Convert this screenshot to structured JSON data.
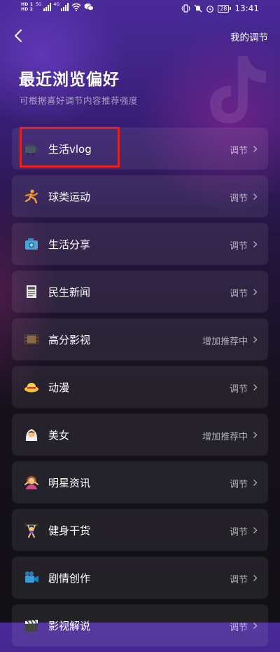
{
  "status_bar": {
    "hd1": "HD 1",
    "hd2": "HD 2",
    "net1": "5G",
    "net2": "4G",
    "battery": "28",
    "time": "13:41"
  },
  "nav": {
    "right_link": "我的调节"
  },
  "header": {
    "title": "最近浏览偏好",
    "subtitle": "可根据喜好调节内容推荐强度"
  },
  "items": [
    {
      "label": "生活vlog",
      "action": "调节",
      "icon": "camera-icon"
    },
    {
      "label": "球类运动",
      "action": "调节",
      "icon": "sports-icon"
    },
    {
      "label": "生活分享",
      "action": "调节",
      "icon": "share-icon"
    },
    {
      "label": "民生新闻",
      "action": "调节",
      "icon": "newspaper-icon"
    },
    {
      "label": "高分影视",
      "action": "增加推荐中",
      "icon": "film-icon"
    },
    {
      "label": "动漫",
      "action": "调节",
      "icon": "hat-icon"
    },
    {
      "label": "美女",
      "action": "增加推荐中",
      "icon": "bride-icon"
    },
    {
      "label": "明星资讯",
      "action": "调节",
      "icon": "star-person-icon"
    },
    {
      "label": "健身干货",
      "action": "调节",
      "icon": "weightlifter-icon"
    },
    {
      "label": "剧情创作",
      "action": "调节",
      "icon": "video-camera-icon"
    },
    {
      "label": "影视解说",
      "action": "调节",
      "icon": "clapper-icon"
    }
  ],
  "colors": {
    "highlight": "#e5211d"
  }
}
